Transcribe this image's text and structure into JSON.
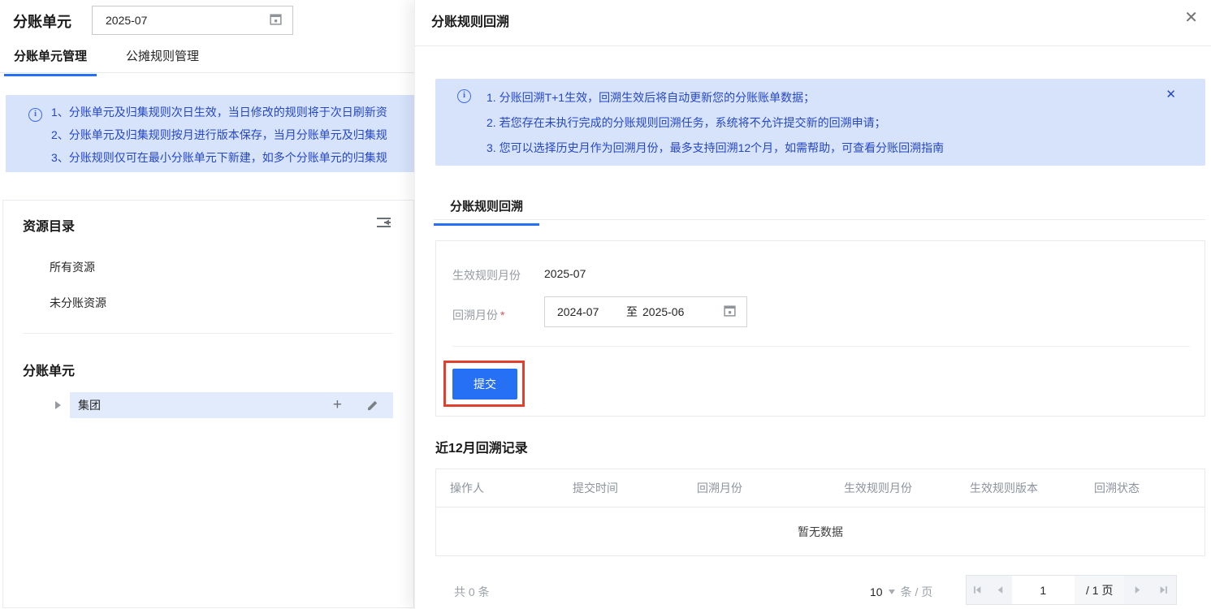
{
  "colors": {
    "primary": "#2670f5",
    "banner_bg": "#d7e3fb",
    "banner_text": "#2547c5",
    "annotation_red": "#e0402d",
    "tree_highlight": "#e1ebfb"
  },
  "page": {
    "title": "分账单元",
    "month_picker_value": "2025-07",
    "tabs": [
      {
        "label": "分账单元管理"
      },
      {
        "label": "公摊规则管理"
      }
    ],
    "notice_lines": [
      "1、分账单元及归集规则次日生效，当日修改的规则将于次日刷新资",
      "2、分账单元及归集规则按月进行版本保存，当月分账单元及归集规",
      "3、分账规则仅可在最小分账单元下新建，如多个分账单元的归集规"
    ],
    "resource_panel": {
      "title": "资源目录",
      "items": [
        "所有资源",
        "未分账资源"
      ],
      "section_title": "分账单元",
      "tree_item_label": "集团"
    }
  },
  "drawer": {
    "title": "分账规则回溯",
    "notice_lines": [
      "1. 分账回溯T+1生效，回溯生效后将自动更新您的分账账单数据；",
      "2. 若您存在未执行完成的分账规则回溯任务，系统将不允许提交新的回溯申请；",
      "3. 您可以选择历史月作为回溯月份，最多支持回溯12个月，如需帮助，可查看分账回溯指南"
    ],
    "tab_label": "分账规则回溯",
    "form": {
      "effective_label": "生效规则月份",
      "effective_value": "2025-07",
      "backtrack_label": "回溯月份",
      "required_mark": "*",
      "range_start": "2024-07",
      "range_separator": "至",
      "range_end": "2025-06",
      "submit_label": "提交"
    },
    "records": {
      "title": "近12月回溯记录",
      "columns": [
        "操作人",
        "提交时间",
        "回溯月份",
        "生效规则月份",
        "生效规则版本",
        "回溯状态"
      ],
      "empty_text": "暂无数据",
      "total_text": "共 0 条",
      "page_size": "10",
      "unit_text": "条 / 页",
      "current_page": "1",
      "total_pages_text": "/ 1 页"
    }
  },
  "icons": {
    "close": "✕"
  }
}
